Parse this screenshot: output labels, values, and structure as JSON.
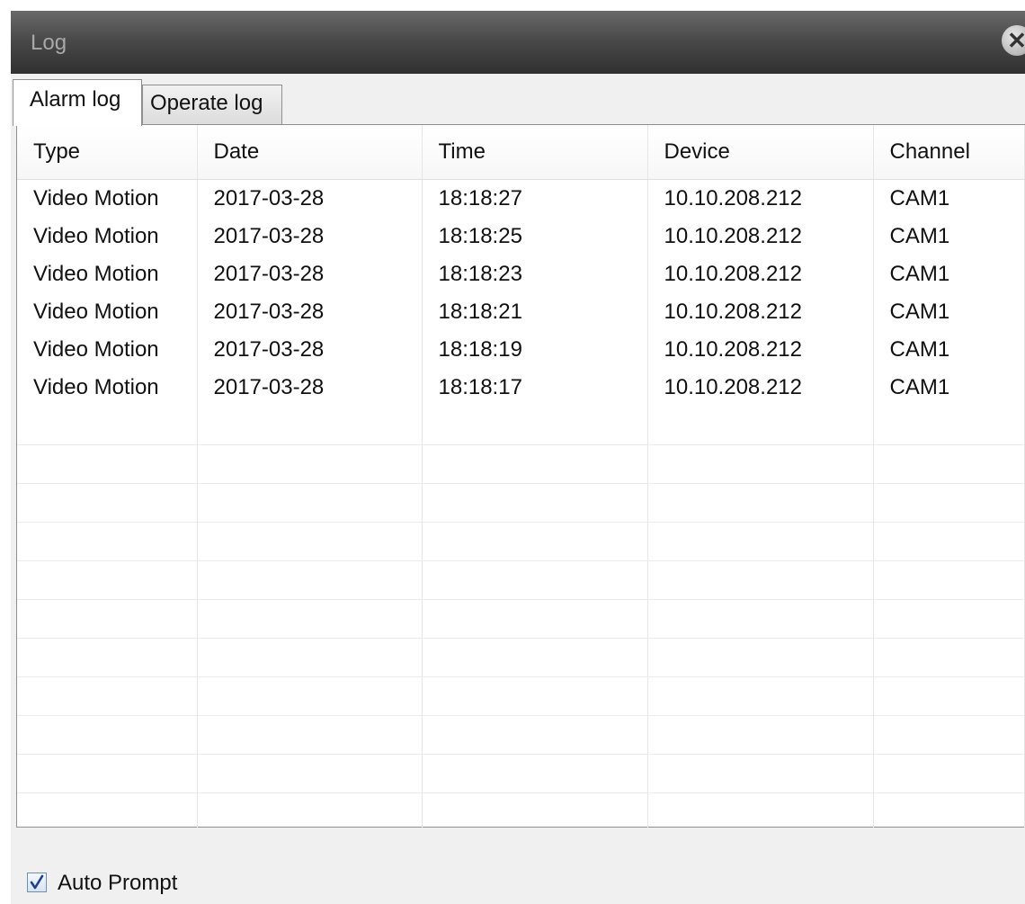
{
  "window": {
    "title": "Log",
    "close_icon": "close-icon"
  },
  "tabs": [
    {
      "label": "Alarm log",
      "active": true
    },
    {
      "label": "Operate log",
      "active": false
    }
  ],
  "table": {
    "columns": [
      "Type",
      "Date",
      "Time",
      "Device",
      "Channel"
    ],
    "rows": [
      [
        "Video Motion",
        "2017-03-28",
        "18:18:27",
        "10.10.208.212",
        "CAM1"
      ],
      [
        "Video Motion",
        "2017-03-28",
        "18:18:25",
        "10.10.208.212",
        "CAM1"
      ],
      [
        "Video Motion",
        "2017-03-28",
        "18:18:23",
        "10.10.208.212",
        "CAM1"
      ],
      [
        "Video Motion",
        "2017-03-28",
        "18:18:21",
        "10.10.208.212",
        "CAM1"
      ],
      [
        "Video Motion",
        "2017-03-28",
        "18:18:19",
        "10.10.208.212",
        "CAM1"
      ],
      [
        "Video Motion",
        "2017-03-28",
        "18:18:17",
        "10.10.208.212",
        "CAM1"
      ]
    ]
  },
  "footer": {
    "auto_prompt_label": "Auto Prompt",
    "auto_prompt_checked": true
  }
}
